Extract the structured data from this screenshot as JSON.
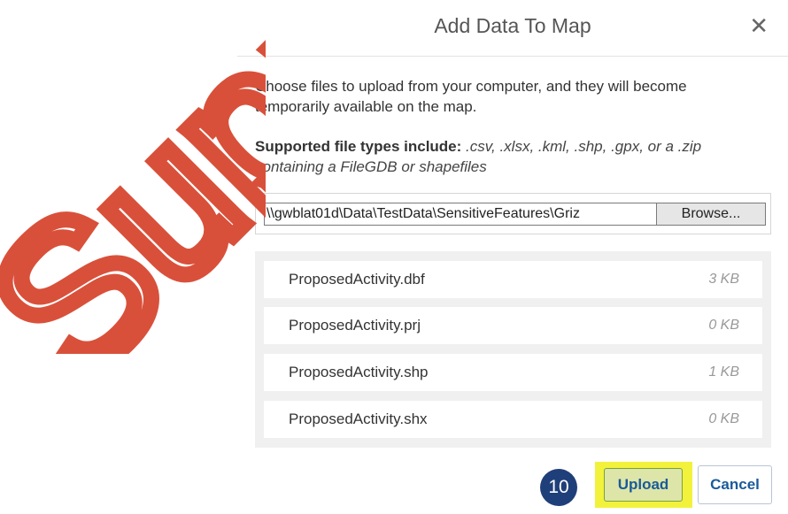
{
  "dialog": {
    "title": "Add Data To Map",
    "close_glyph": "✕",
    "intro": "Choose files to upload from your computer, and they will become temporarily available on the map.",
    "types_label": "Supported file types include:",
    "types_list": ".csv, .xlsx, .kml, .shp, .gpx, or a .zip containing a FileGDB or shapefiles",
    "file_path": "\\\\gwblat01d\\Data\\TestData\\SensitiveFeatures\\Griz",
    "browse_label": "Browse...",
    "files": [
      {
        "name": "ProposedActivity.dbf",
        "size": "3 KB"
      },
      {
        "name": "ProposedActivity.prj",
        "size": "0 KB"
      },
      {
        "name": "ProposedActivity.shp",
        "size": "1 KB"
      },
      {
        "name": "ProposedActivity.shx",
        "size": "0 KB"
      }
    ],
    "upload_label": "Upload",
    "cancel_label": "Cancel"
  },
  "annotation": {
    "step_number": "10",
    "watermark_text": "Supp",
    "watermark_color": "#d9503a",
    "highlight_color": "#f2f23c"
  }
}
